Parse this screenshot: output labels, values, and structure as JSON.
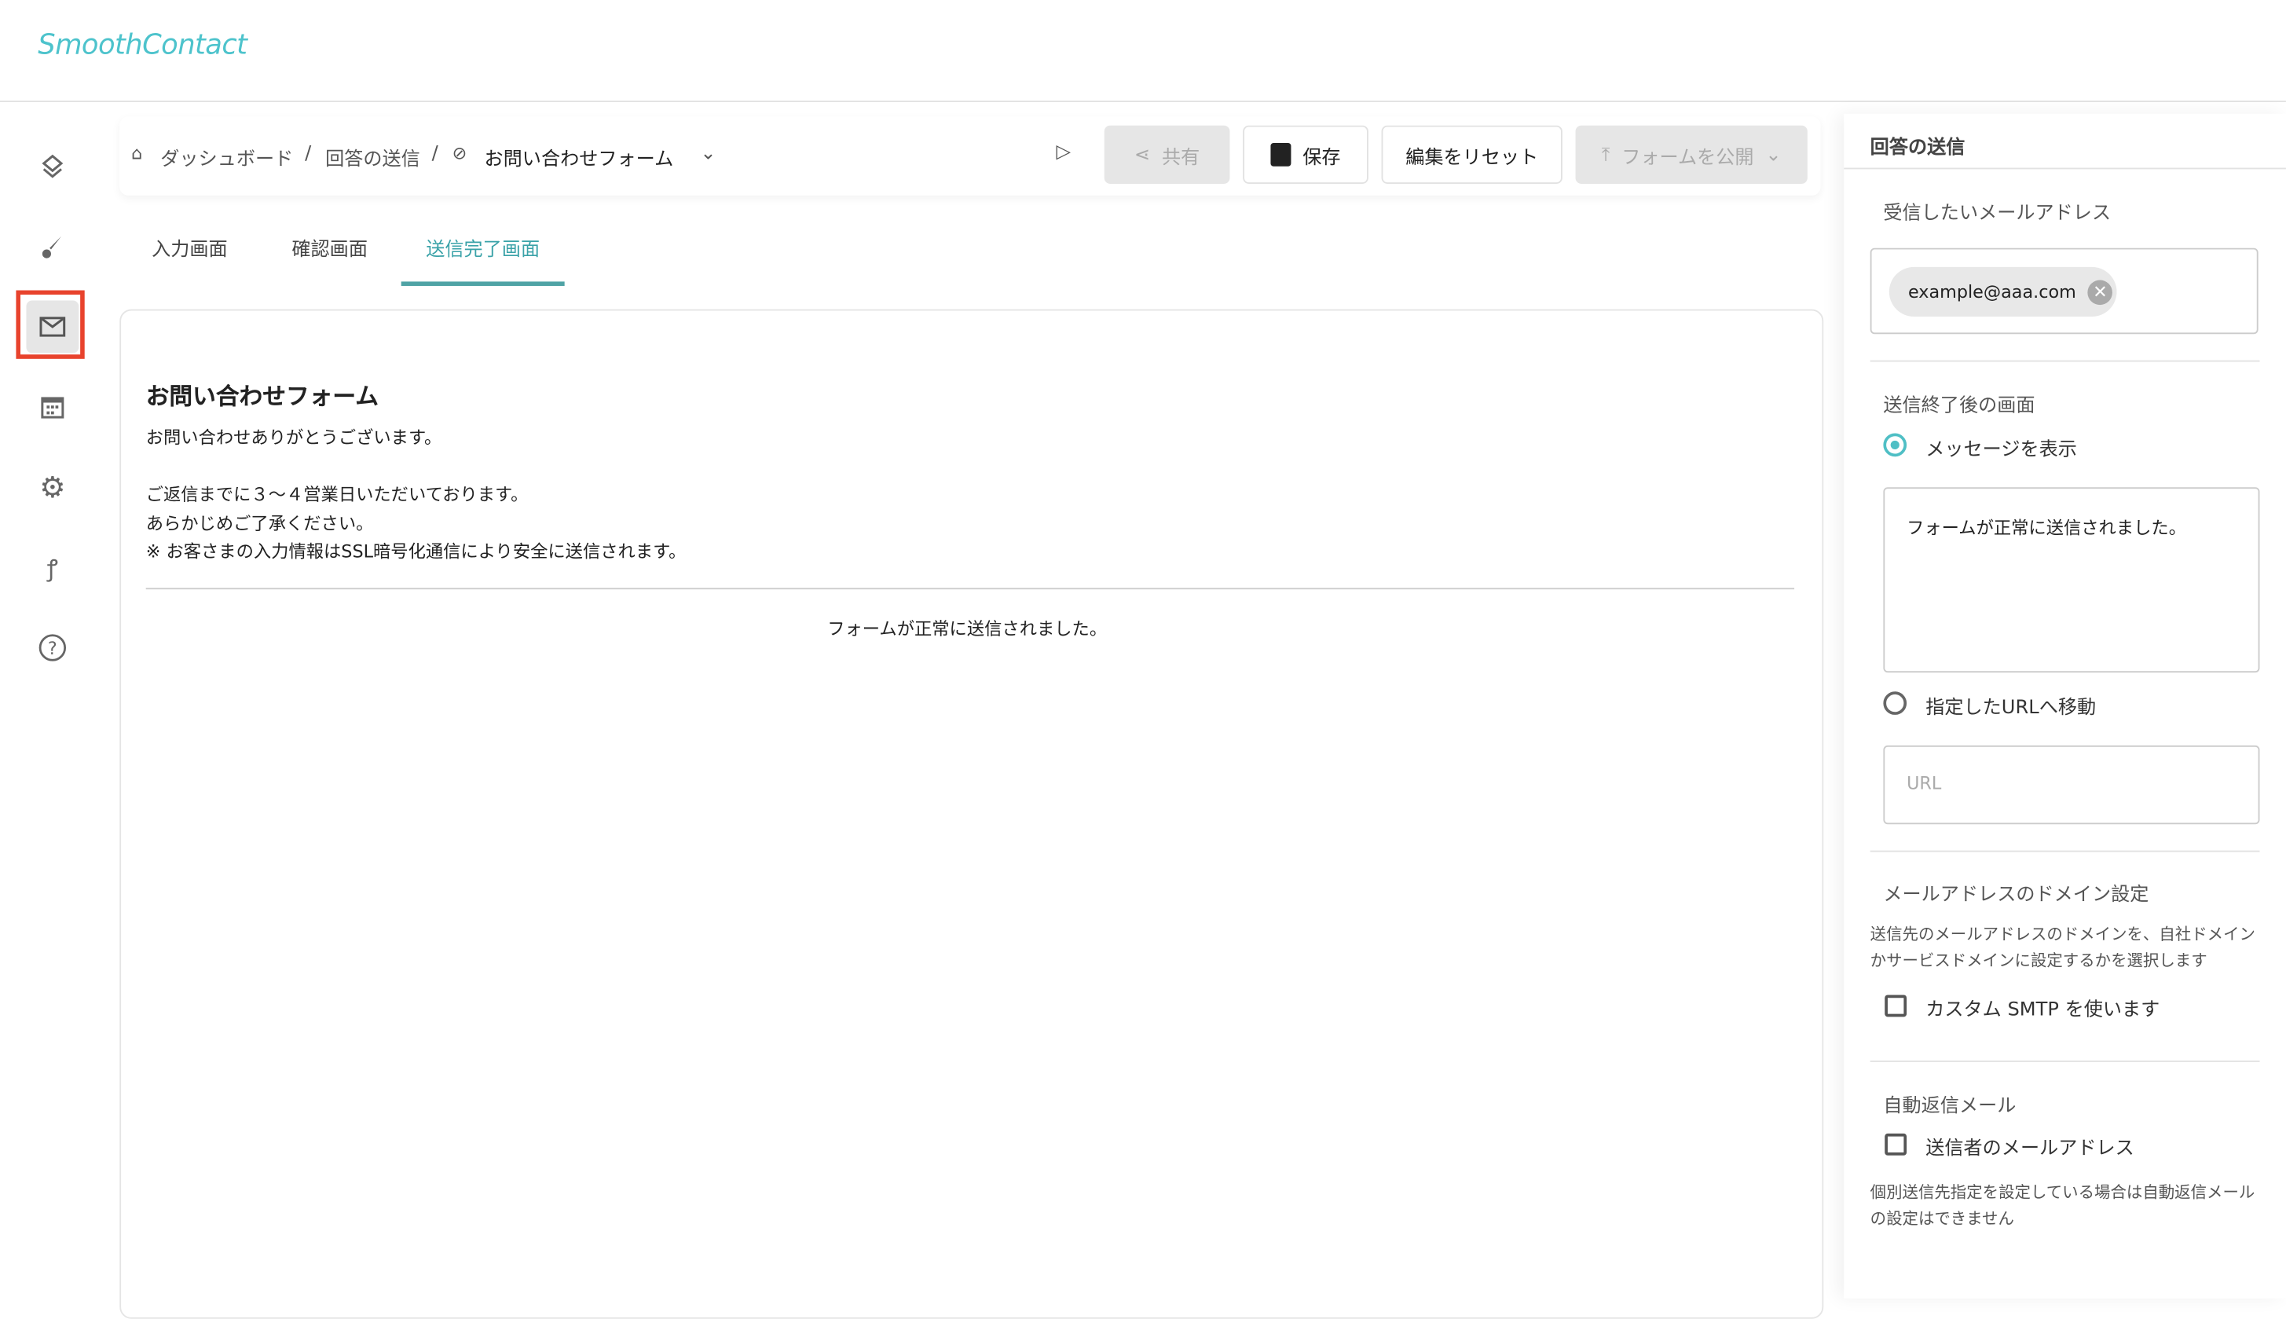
{
  "app": {
    "logo_light": "Smooth",
    "logo_bold": "Contact",
    "accent": "#4fbfc5"
  },
  "sidebar": {
    "items": [
      {
        "icon": "layers-icon"
      },
      {
        "icon": "brush-icon"
      },
      {
        "icon": "mail-icon",
        "active": true
      },
      {
        "icon": "calendar-icon"
      },
      {
        "icon": "gear-icon"
      },
      {
        "icon": "integration-icon"
      },
      {
        "icon": "help-icon"
      }
    ]
  },
  "breadcrumb": {
    "home": "ダッシュボード",
    "section": "回答の送信",
    "form": "お問い合わせフォーム"
  },
  "toolbar": {
    "share": "共有",
    "save": "保存",
    "reset": "編集をリセット",
    "publish": "フォームを公開"
  },
  "tabs": [
    {
      "label": "入力画面"
    },
    {
      "label": "確認画面"
    },
    {
      "label": "送信完了画面",
      "active": true
    }
  ],
  "preview": {
    "title": "お問い合わせフォーム",
    "line1": "お問い合わせありがとうございます。",
    "line2": "ご返信までに３～４営業日いただいております。",
    "line3": "あらかじめご了承ください。",
    "line4": "※ お客さまの入力情報はSSL暗号化通信により安全に送信されます。",
    "message": "フォームが正常に送信されました。"
  },
  "panel": {
    "title": "回答の送信",
    "email_label": "受信したいメールアドレス",
    "email_chip": "example@aaa.com",
    "after_label": "送信終了後の画面",
    "option_message": "メッセージを表示",
    "message_value": "フォームが正常に送信されました。",
    "option_url": "指定したURLへ移動",
    "url_placeholder": "URL",
    "domain_label": "メールアドレスのドメイン設定",
    "domain_help": "送信先のメールアドレスのドメインを、自社ドメインかサービスドメインに設定するかを選択します",
    "smtp_label": "カスタム SMTP を使います",
    "auto_label": "自動返信メール",
    "auto_check": "送信者のメールアドレス",
    "auto_help": "個別送信先指定を設定している場合は自動返信メールの設定はできません"
  }
}
